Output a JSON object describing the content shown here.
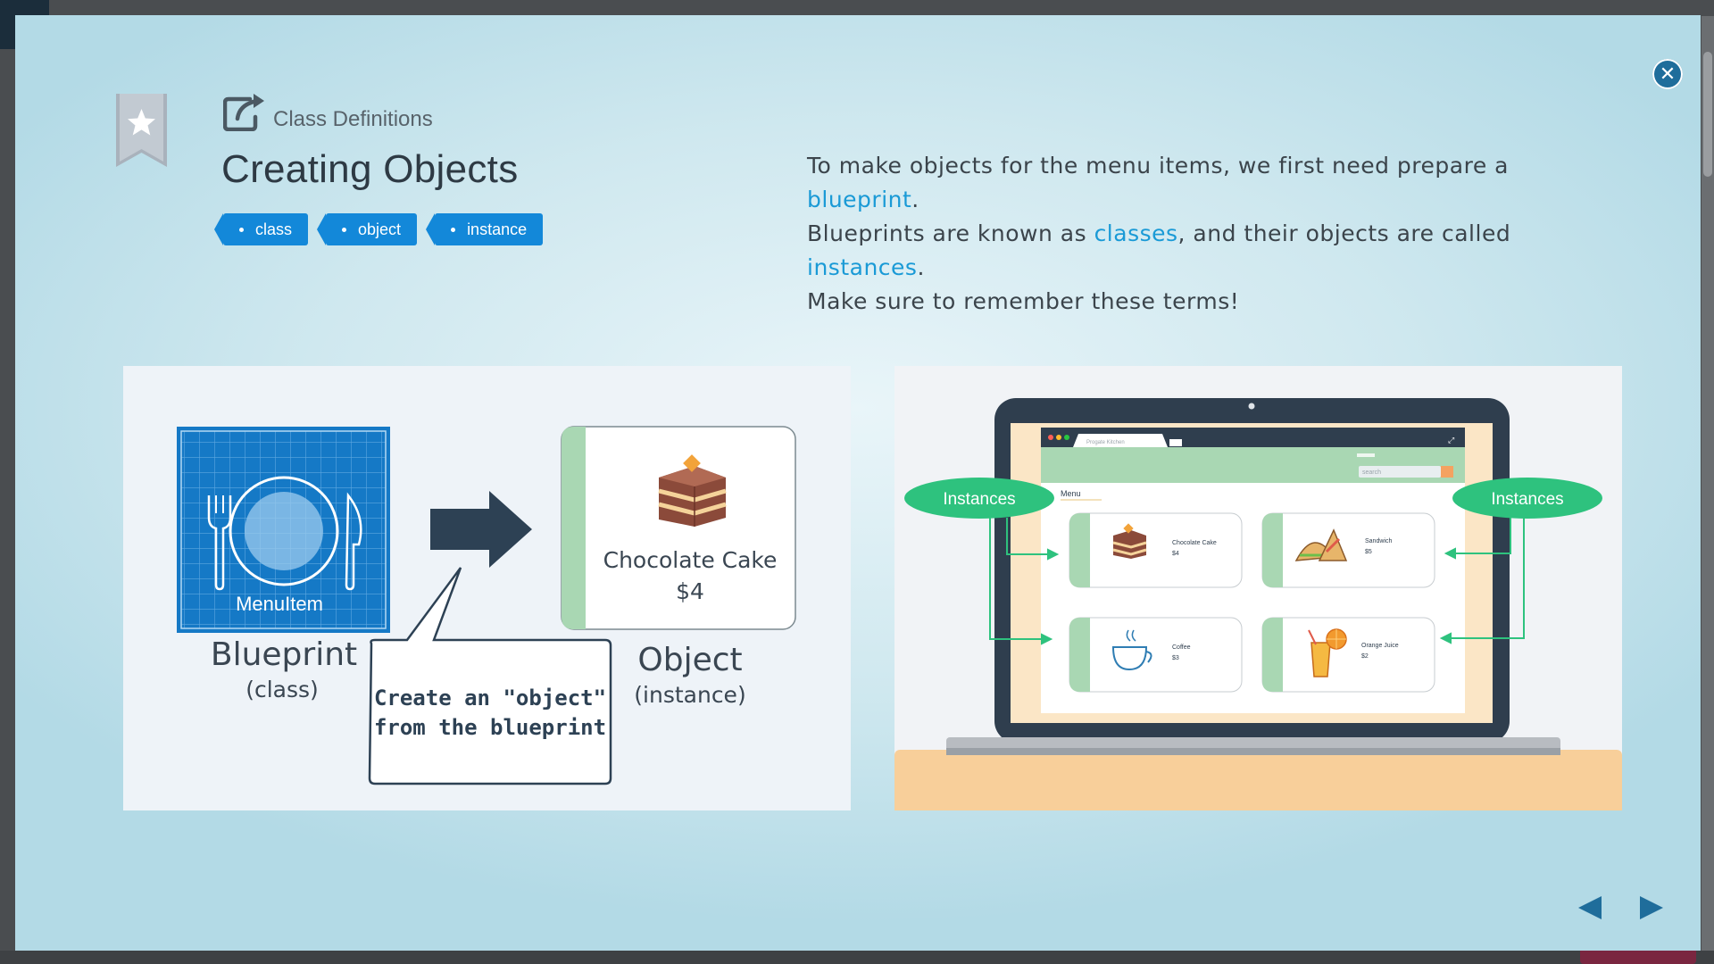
{
  "header": {
    "subtitle": "Class Definitions",
    "title": "Creating Objects"
  },
  "tags": [
    "class",
    "object",
    "instance"
  ],
  "description": {
    "line1_a": "To make objects for the menu items, we first need prepare a ",
    "line1_hl": "blueprint",
    "line1_b": ".",
    "line2_a": "Blueprints are known as ",
    "line2_hl1": "classes",
    "line2_b": ", and their objects are called ",
    "line2_hl2": "instances",
    "line2_c": ".",
    "line3": "Make sure to remember these terms!"
  },
  "left_diagram": {
    "blueprint_text": "MenuItem",
    "blueprint_label": "Blueprint",
    "blueprint_sublabel": "(class)",
    "object_name": "Chocolate Cake",
    "object_price": "$4",
    "object_label": "Object",
    "object_sublabel": "(instance)",
    "bubble_line1": "Create an \"object\"",
    "bubble_line2": "from the blueprint"
  },
  "right_diagram": {
    "instances_left": "Instances",
    "instances_right": "Instances",
    "browser_tab": "Progate Kitchen",
    "search_placeholder": "search",
    "menu_label": "Menu",
    "items": [
      {
        "name": "Chocolate Cake",
        "price": "$4"
      },
      {
        "name": "Sandwich",
        "price": "$5"
      },
      {
        "name": "Coffee",
        "price": "$3"
      },
      {
        "name": "Orange Juice",
        "price": "$2"
      }
    ]
  },
  "colors": {
    "tag": "#1388d9",
    "highlight": "#1a9ad6",
    "blueprint": "#1579c6",
    "instances": "#2ec27e",
    "laptop": "#2f3e4e"
  },
  "icons": {
    "close": "close-icon",
    "bookmark": "star-bookmark-icon",
    "external": "external-link-icon",
    "prev": "prev-arrow-icon",
    "next": "next-arrow-icon"
  }
}
